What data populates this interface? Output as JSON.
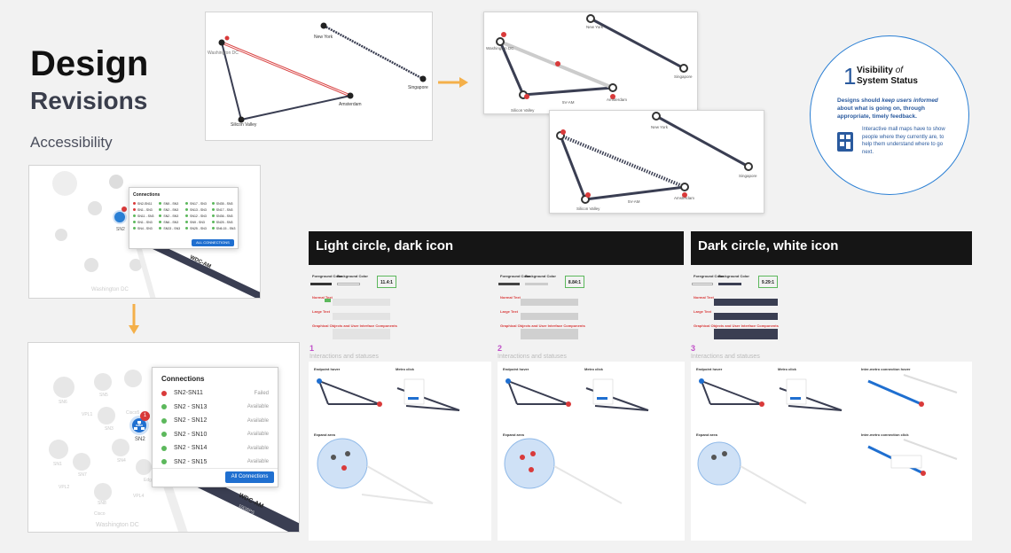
{
  "page": {
    "title": "Design",
    "subtitle": "Revisions",
    "section": "Accessibility"
  },
  "map1": {
    "cities": [
      "New York",
      "Washington DC",
      "Singapore",
      "Silicon Valley",
      "Amsterdam"
    ],
    "badge": "1"
  },
  "map2": {
    "cities": [
      "New York",
      "Washington DC",
      "Singapore",
      "Silicon Valley",
      "Amsterdam"
    ],
    "link_label": "5V-AM",
    "wdc_label": "WDC-AM"
  },
  "visibility": {
    "number": "1",
    "title_a": "Visibility",
    "title_of": "of",
    "title_b": "System Status",
    "lead_a": "Designs should ",
    "lead_em": "keep users informed",
    "lead_b": " about what is going on, through appropriate, timely feedback.",
    "body": "Interactive mall maps have to show people where they currently are, to help them understand where to go next."
  },
  "connections_small": {
    "title": "Connections",
    "button": "ALL CONNECTIONS",
    "cols": [
      [
        "SN2-SN11",
        "SN1 - SN3",
        "SN11 - SN3",
        "SN1 - SN3",
        "SN4 - SN3"
      ],
      [
        "SN5 - SN3",
        "SN2 - SN3",
        "SN2 - SN3",
        "SN6 - SN3",
        "SN33 - SN3"
      ],
      [
        "SN17 - SN3",
        "SN13 - SN3",
        "SN12 - SN3",
        "SN9 - SN3",
        "SN25 - SN3"
      ],
      [
        "SN35 - SN3",
        "SN17 - SN3",
        "SN36 - SN3",
        "SN25 - SN3",
        "SN6.15 - SN3"
      ]
    ],
    "node": "SN2",
    "link": "WDC-AM",
    "region": "Washington DC"
  },
  "connections_large": {
    "title": "Connections",
    "rows": [
      {
        "name": "SN2-SN11",
        "status": "Failed",
        "color": "#d93a3a"
      },
      {
        "name": "SN2 - SN13",
        "status": "Available",
        "color": "#5cb85c"
      },
      {
        "name": "SN2 - SN12",
        "status": "Available",
        "color": "#5cb85c"
      },
      {
        "name": "SN2 - SN10",
        "status": "Available",
        "color": "#5cb85c"
      },
      {
        "name": "SN2 - SN14",
        "status": "Available",
        "color": "#5cb85c"
      },
      {
        "name": "SN2 - SN15",
        "status": "Available",
        "color": "#5cb85c"
      }
    ],
    "button": "All Connections",
    "node": "SN2",
    "badge": "1",
    "link_a": "WDC-AM",
    "link_b": "10GBPS",
    "region": "Washington DC",
    "bg_labels": [
      "SN6",
      "SN5",
      "VPL1",
      "Cisco5",
      "SN3",
      "SN1",
      "SN7",
      "SN4",
      "SN8",
      "VPL2",
      "Edge1",
      "VPL4",
      "Cisco"
    ]
  },
  "contrast": {
    "light_title": "Light circle, dark icon",
    "dark_title": "Dark circle, white icon",
    "ratios": [
      "11.4:1",
      "8.84:1",
      "9.29:1"
    ],
    "labels": {
      "normal": "Normal Text",
      "large": "Large Text",
      "graphical": "Graphical Objects and User Interface Components",
      "sample": "The five boxing wizards jump quickly."
    },
    "fg": "Foreground Color",
    "bg": "Background Color",
    "cr": "Contrast Ratio"
  },
  "sections": [
    {
      "num": "1",
      "label": "Interactions and statuses",
      "panels": [
        "Endpoint hover",
        "Metro click",
        "Expand area"
      ]
    },
    {
      "num": "2",
      "label": "Interactions and statuses",
      "panels": [
        "Endpoint hover",
        "Metro click",
        "Expand area"
      ]
    },
    {
      "num": "3",
      "label": "Interactions and statuses",
      "panels": [
        "Endpoint hover",
        "Metro click",
        "Inter-metro connection hover",
        "Expand area",
        "Inter-metro connection click"
      ]
    }
  ],
  "colors": {
    "accent_blue": "#1f6fd0",
    "failed_red": "#d93a3a",
    "ok_green": "#5cb85c",
    "arrow_orange": "#f4b04a",
    "magenta": "#c050c8",
    "navy": "#3a3e52"
  }
}
